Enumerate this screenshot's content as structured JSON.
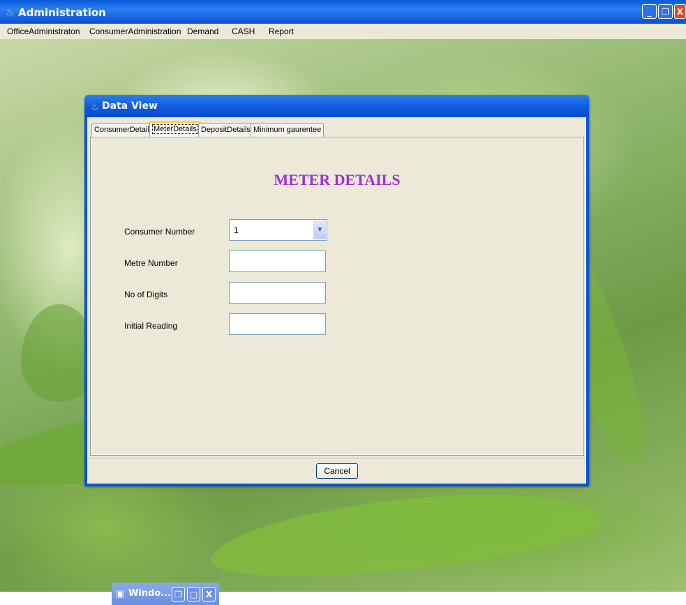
{
  "window": {
    "title": "Administration",
    "minimize_icon": "_",
    "restore_icon": "❐",
    "close_icon": "X"
  },
  "menu": [
    "OfficeAdministraton",
    "ConsumerAdministration",
    "Demand",
    "CASH",
    "Report"
  ],
  "dialog": {
    "title": "Data View",
    "tabs": [
      "ConsumerDetails",
      "MeterDetails",
      "DepositDetails",
      "Minimum gaurentee"
    ],
    "active_tab": "MeterDetails",
    "heading": "METER DETAILS",
    "fields": {
      "consumer_number": {
        "label": "Consumer Number",
        "value": "1"
      },
      "metre_number": {
        "label": "Metre Number",
        "value": ""
      },
      "no_of_digits": {
        "label": "No of Digits",
        "value": ""
      },
      "initial_reading": {
        "label": "Initial Reading",
        "value": ""
      }
    },
    "cancel_label": "Cancel"
  },
  "minimized_window": {
    "title": "Windo..."
  },
  "colors": {
    "heading": "#a02fd8",
    "titlebar": "#0a52d8",
    "dialog_bg": "#ece9d8"
  }
}
